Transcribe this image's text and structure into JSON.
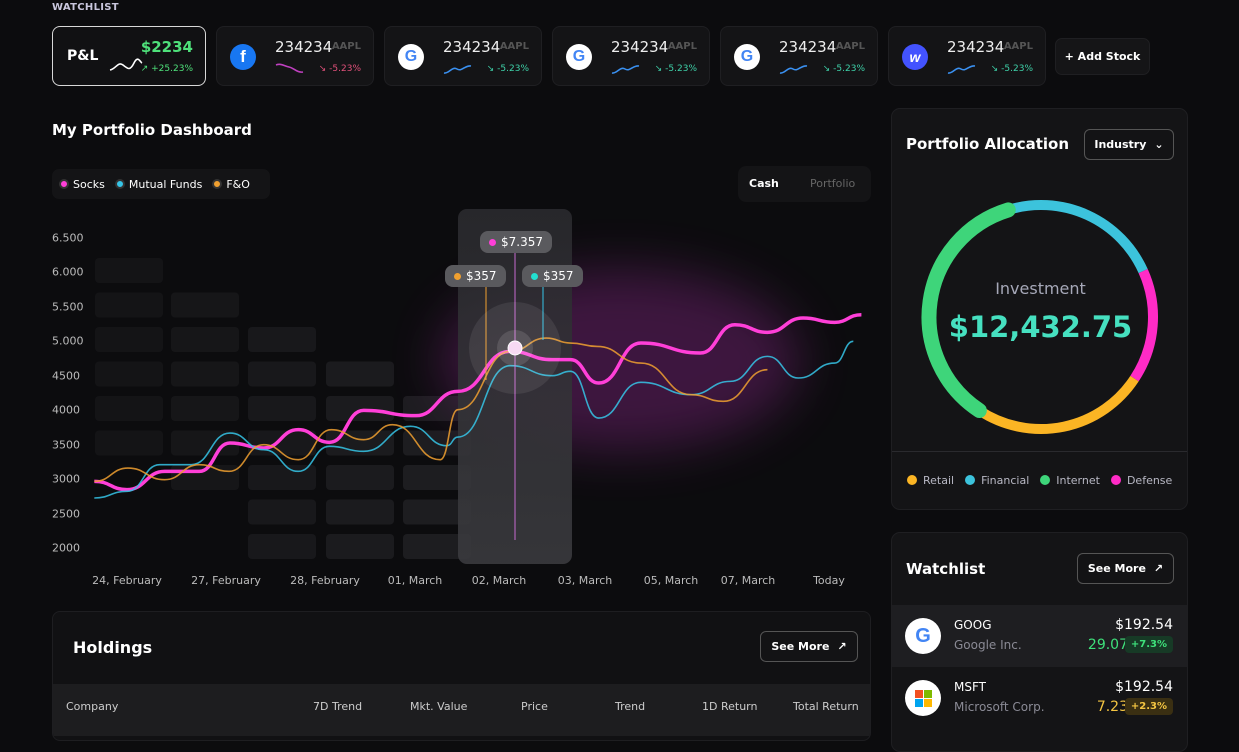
{
  "watchlist_strip": {
    "label": "WATCHLIST",
    "pl": {
      "label": "P&L",
      "value": "$2234",
      "change": "+25.23%"
    },
    "stocks": [
      {
        "logo": "facebook-icon",
        "value": "234234",
        "ticker": "AAPL",
        "change": "-5.23%",
        "trend": "down"
      },
      {
        "logo": "google-icon",
        "value": "234234",
        "ticker": "AAPL",
        "change": "-5.23%",
        "trend": "up"
      },
      {
        "logo": "google-icon",
        "value": "234234",
        "ticker": "AAPL",
        "change": "-5.23%",
        "trend": "up"
      },
      {
        "logo": "google-icon",
        "value": "234234",
        "ticker": "AAPL",
        "change": "-5.23%",
        "trend": "up"
      },
      {
        "logo": "webflow-icon",
        "value": "234234",
        "ticker": "AAPL",
        "change": "-5.23%",
        "trend": "up"
      }
    ],
    "add_label": "+ Add Stock"
  },
  "dashboard": {
    "title": "My Portfolio Dashboard",
    "legend": [
      {
        "label": "Socks",
        "color": "#ff3fd8"
      },
      {
        "label": "Mutual Funds",
        "color": "#36c5e8"
      },
      {
        "label": "F&O",
        "color": "#f0a030"
      }
    ],
    "toggle": {
      "active": "Cash",
      "inactive": "Portfolio"
    },
    "tooltips": {
      "stocks": "$7.357",
      "fo": "$357",
      "mf": "$357"
    }
  },
  "chart_data": {
    "type": "line",
    "categories": [
      "24, February",
      "27, February",
      "28, February",
      "01, March",
      "02, March",
      "03, March",
      "05, March",
      "07, March",
      "Today"
    ],
    "yticks": [
      "6.500",
      "6.000",
      "5.500",
      "5.000",
      "4500",
      "4000",
      "3500",
      "3000",
      "2500",
      "2000"
    ],
    "ylim": [
      2000,
      6500
    ],
    "highlight_category": "02, March",
    "series": [
      {
        "name": "Socks",
        "color": "#ff3fd8",
        "points": [
          [
            -0.33,
            2968
          ],
          [
            0,
            2847
          ],
          [
            0.38,
            3113
          ],
          [
            0.73,
            3113
          ],
          [
            1.04,
            3524
          ],
          [
            1.38,
            3452
          ],
          [
            1.73,
            3718
          ],
          [
            2.05,
            3534
          ],
          [
            2.43,
            3998
          ],
          [
            3.01,
            3921
          ],
          [
            3.51,
            4274
          ],
          [
            4.13,
            4855
          ],
          [
            4.62,
            4734
          ],
          [
            4.83,
            4734
          ],
          [
            5.16,
            4395
          ],
          [
            5.65,
            4976
          ],
          [
            6.38,
            4831
          ],
          [
            6.83,
            5242
          ],
          [
            7.24,
            5131
          ],
          [
            7.68,
            5339
          ],
          [
            8.07,
            5276
          ],
          [
            8.4,
            5387
          ]
        ]
      },
      {
        "name": "Mutual Funds",
        "color": "#36c5e8",
        "points": [
          [
            -0.33,
            2726
          ],
          [
            0,
            2823
          ],
          [
            0.33,
            3210
          ],
          [
            0.65,
            3210
          ],
          [
            1.04,
            3669
          ],
          [
            1.38,
            3427
          ],
          [
            1.73,
            3113
          ],
          [
            2.05,
            3476
          ],
          [
            2.43,
            3403
          ],
          [
            2.95,
            3766
          ],
          [
            3.38,
            3485
          ],
          [
            3.51,
            3611
          ],
          [
            4.13,
            4647
          ],
          [
            4.62,
            4502
          ],
          [
            4.83,
            4565
          ],
          [
            5.16,
            3887
          ],
          [
            5.65,
            4405
          ],
          [
            6.26,
            4226
          ],
          [
            6.77,
            4419
          ],
          [
            7.24,
            4782
          ],
          [
            7.62,
            4468
          ],
          [
            8.07,
            4685
          ],
          [
            8.3,
            5000
          ]
        ]
      },
      {
        "name": "F&O",
        "color": "#f0a030",
        "points": [
          [
            -0.33,
            2968
          ],
          [
            0.01,
            3161
          ],
          [
            0.38,
            2992
          ],
          [
            0.73,
            3210
          ],
          [
            1.03,
            3113
          ],
          [
            1.38,
            3500
          ],
          [
            1.73,
            3282
          ],
          [
            2.07,
            3718
          ],
          [
            2.43,
            3573
          ],
          [
            2.75,
            3790
          ],
          [
            3.3,
            3282
          ],
          [
            3.51,
            4008
          ],
          [
            4.13,
            4855
          ],
          [
            4.55,
            5048
          ],
          [
            4.83,
            4976
          ],
          [
            5.14,
            4927
          ],
          [
            5.65,
            4685
          ],
          [
            6.26,
            4226
          ],
          [
            6.68,
            4129
          ],
          [
            7.24,
            4589
          ]
        ]
      }
    ]
  },
  "holdings": {
    "title": "Holdings",
    "see_more": "See More",
    "columns": [
      "Company",
      "7D Trend",
      "Mkt. Value",
      "Price",
      "Trend",
      "1D Return",
      "Total Return"
    ]
  },
  "allocation": {
    "title": "Portfolio Allocation",
    "dropdown": "Industry",
    "center_label": "Investment",
    "center_value": "$12,432.75",
    "slices": [
      {
        "label": "Financial",
        "color": "#3cc3dc",
        "percent": 23
      },
      {
        "label": "Defense",
        "color": "#ff2bc6",
        "percent": 16
      },
      {
        "label": "Retail",
        "color": "#fbb524",
        "percent": 25
      },
      {
        "label": "Internet",
        "color": "#3ed57a",
        "percent": 36
      }
    ],
    "legend": [
      {
        "label": "Retail",
        "color": "#fbb524"
      },
      {
        "label": "Financial",
        "color": "#3cc3dc"
      },
      {
        "label": "Internet",
        "color": "#3ed57a"
      },
      {
        "label": "Defense",
        "color": "#ff2bc6"
      }
    ]
  },
  "watchlist": {
    "title": "Watchlist",
    "see_more": "See More",
    "items": [
      {
        "ticker": "GOOG",
        "name": "Google Inc.",
        "price": "$192.54",
        "change": "29.07",
        "pct": "+7.3%",
        "color": "#3ee07a",
        "badge": "#173a26"
      },
      {
        "ticker": "MSFT",
        "name": "Microsoft Corp.",
        "price": "$192.54",
        "change": "7.23",
        "pct": "+2.3%",
        "color": "#f4c542",
        "badge": "#3a2f12"
      }
    ]
  }
}
